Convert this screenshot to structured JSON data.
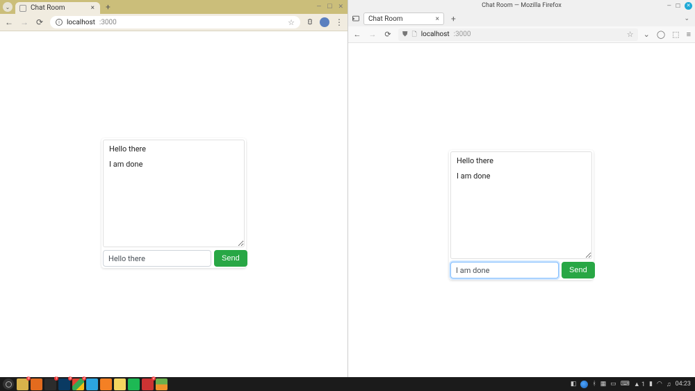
{
  "left": {
    "browser": "chrome",
    "tab_title": "Chat Room",
    "address_host": "localhost",
    "address_port": ":3000",
    "chat_messages": [
      "Hello there",
      "I am done"
    ],
    "input_value": "Hello there",
    "send_label": "Send"
  },
  "right": {
    "browser": "firefox",
    "titlebar": "Chat Room — Mozilla Firefox",
    "tab_title": "Chat Room",
    "address_host": "localhost",
    "address_port": ":3000",
    "chat_messages": [
      "Hello there",
      "I am done"
    ],
    "input_value": "I am done ",
    "input_focused": true,
    "send_label": "Send"
  },
  "taskbar": {
    "apps": [
      {
        "name": "files",
        "cls": "yellow",
        "badge": "3"
      },
      {
        "name": "firefox",
        "cls": "orange"
      },
      {
        "name": "terminal",
        "cls": "dark",
        "badge": "1"
      },
      {
        "name": "vscode",
        "cls": "vscode",
        "badge": "3"
      },
      {
        "name": "chrome",
        "cls": "chrome",
        "badge": "2"
      },
      {
        "name": "telegram",
        "cls": "telegram"
      },
      {
        "name": "stackoverflow",
        "cls": "stack"
      },
      {
        "name": "notes",
        "cls": "note"
      },
      {
        "name": "spotify",
        "cls": "spotify"
      },
      {
        "name": "app1",
        "cls": "red",
        "badge": "2"
      },
      {
        "name": "app2",
        "cls": "pic"
      }
    ],
    "tray": {
      "clock": "04:23",
      "vpn_count": "1"
    }
  }
}
